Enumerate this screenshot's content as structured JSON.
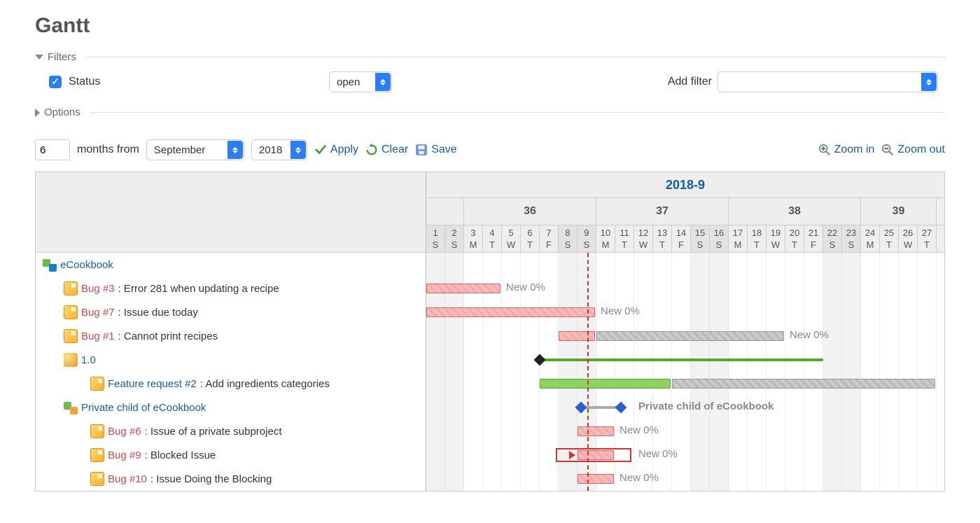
{
  "page": {
    "title": "Gantt"
  },
  "filters": {
    "legend": "Filters",
    "status_label": "Status",
    "status_value": "open",
    "add_filter_label": "Add filter"
  },
  "options": {
    "legend": "Options"
  },
  "controls": {
    "months_value": "6",
    "months_from": "months from",
    "month_select": "September",
    "year_select": "2018",
    "apply": "Apply",
    "clear": "Clear",
    "save": "Save",
    "zoom_in": "Zoom in",
    "zoom_out": "Zoom out"
  },
  "timeline": {
    "month_label": "2018-9",
    "weeks": [
      {
        "label": "",
        "days": 2
      },
      {
        "label": "36",
        "days": 7
      },
      {
        "label": "37",
        "days": 7
      },
      {
        "label": "38",
        "days": 7
      },
      {
        "label": "39",
        "days": 4
      }
    ],
    "days": [
      {
        "n": "1",
        "d": "S",
        "wk": true
      },
      {
        "n": "2",
        "d": "S",
        "wk": true
      },
      {
        "n": "3",
        "d": "M"
      },
      {
        "n": "4",
        "d": "T"
      },
      {
        "n": "5",
        "d": "W"
      },
      {
        "n": "6",
        "d": "T"
      },
      {
        "n": "7",
        "d": "F"
      },
      {
        "n": "8",
        "d": "S",
        "wk": true
      },
      {
        "n": "9",
        "d": "S",
        "wk": true
      },
      {
        "n": "10",
        "d": "M"
      },
      {
        "n": "11",
        "d": "T"
      },
      {
        "n": "12",
        "d": "W"
      },
      {
        "n": "13",
        "d": "T"
      },
      {
        "n": "14",
        "d": "F"
      },
      {
        "n": "15",
        "d": "S",
        "wk": true
      },
      {
        "n": "16",
        "d": "S",
        "wk": true
      },
      {
        "n": "17",
        "d": "M"
      },
      {
        "n": "18",
        "d": "T"
      },
      {
        "n": "19",
        "d": "W"
      },
      {
        "n": "20",
        "d": "T"
      },
      {
        "n": "21",
        "d": "F"
      },
      {
        "n": "22",
        "d": "S",
        "wk": true
      },
      {
        "n": "23",
        "d": "S",
        "wk": true
      },
      {
        "n": "24",
        "d": "M"
      },
      {
        "n": "25",
        "d": "T"
      },
      {
        "n": "26",
        "d": "W"
      },
      {
        "n": "27",
        "d": "T"
      }
    ],
    "today_col": 9
  },
  "rows": [
    {
      "type": "project",
      "name": "eCookbook",
      "indent": 0
    },
    {
      "type": "issue",
      "id": "Bug #3",
      "subject": ": Error 281 when updating a recipe",
      "indent": 1,
      "status": "New 0%"
    },
    {
      "type": "issue",
      "id": "Bug #7",
      "subject": ": Issue due today",
      "indent": 1,
      "status": "New 0%"
    },
    {
      "type": "issue",
      "id": "Bug #1",
      "subject": ": Cannot print recipes",
      "indent": 1,
      "status": "New 0%"
    },
    {
      "type": "version",
      "name": "1.0",
      "indent": 1
    },
    {
      "type": "feature",
      "id": "Feature request #2",
      "subject": ": Add ingredients categories",
      "indent": 2
    },
    {
      "type": "project",
      "name": "Private child of eCookbook",
      "indent": 1,
      "label": "Private child of eCookbook"
    },
    {
      "type": "issue",
      "id": "Bug #6",
      "subject": ": Issue of a private subproject",
      "indent": 2,
      "status": "New 0%"
    },
    {
      "type": "issue",
      "id": "Bug #9",
      "subject": ": Blocked Issue",
      "indent": 2,
      "status": "New 0%"
    },
    {
      "type": "issue",
      "id": "Bug #10",
      "subject": ": Issue Doing the Blocking",
      "indent": 2,
      "status": "New 0%"
    }
  ]
}
